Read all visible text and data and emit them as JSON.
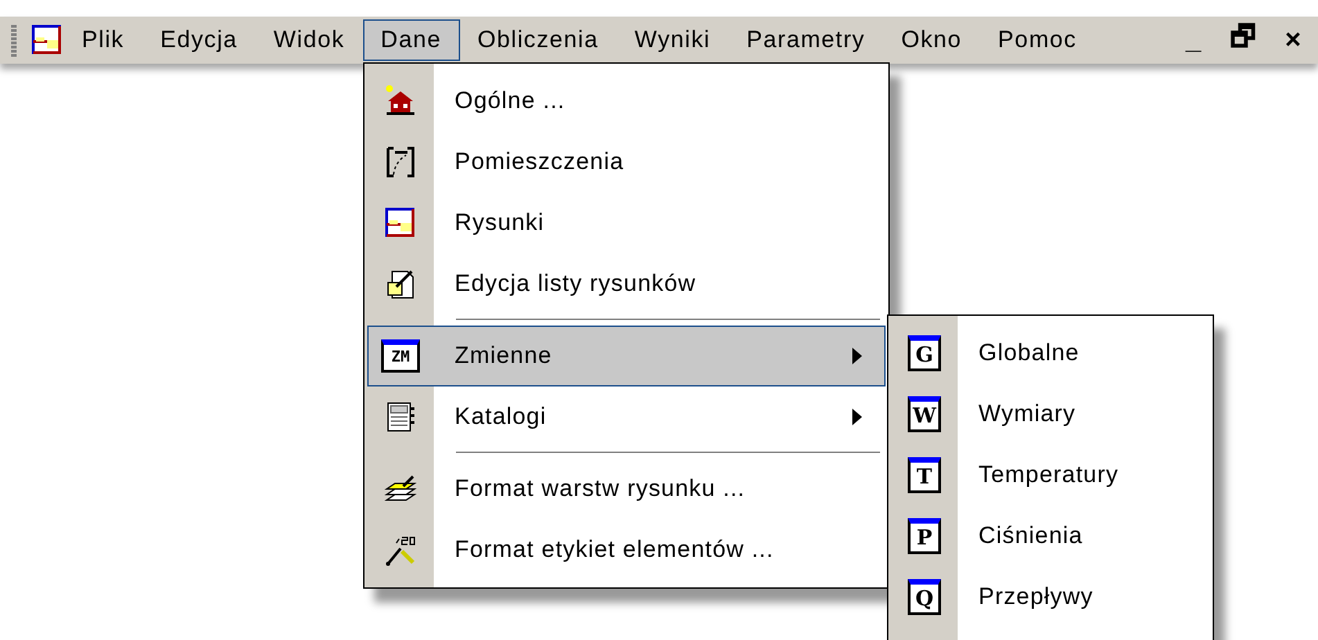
{
  "menubar": {
    "items": [
      {
        "label": "Plik",
        "selected": false
      },
      {
        "label": "Edycja",
        "selected": false
      },
      {
        "label": "Widok",
        "selected": false
      },
      {
        "label": "Dane",
        "selected": true
      },
      {
        "label": "Obliczenia",
        "selected": false
      },
      {
        "label": "Wyniki",
        "selected": false
      },
      {
        "label": "Parametry",
        "selected": false
      },
      {
        "label": "Okno",
        "selected": false
      },
      {
        "label": "Pomoc",
        "selected": false
      }
    ],
    "window_controls": [
      "_",
      "🗗",
      "×"
    ]
  },
  "menu": {
    "items": [
      {
        "kind": "item",
        "label": "Ogólne ...",
        "selected": false,
        "submenu": false
      },
      {
        "kind": "item",
        "label": "Pomieszczenia",
        "selected": false,
        "submenu": false
      },
      {
        "kind": "item",
        "label": "Rysunki",
        "selected": false,
        "submenu": false
      },
      {
        "kind": "item",
        "label": "Edycja listy rysunków",
        "selected": false,
        "submenu": false
      },
      {
        "kind": "separator"
      },
      {
        "kind": "item",
        "icon_text": "ZM",
        "label": "Zmienne",
        "selected": true,
        "submenu": true
      },
      {
        "kind": "item",
        "label": "Katalogi",
        "selected": false,
        "submenu": true
      },
      {
        "kind": "separator"
      },
      {
        "kind": "item",
        "label": "Format warstw rysunku ...",
        "selected": false,
        "submenu": false
      },
      {
        "kind": "item",
        "label": "Format etykiet elementów ...",
        "selected": false,
        "submenu": false
      }
    ]
  },
  "submenu": {
    "items": [
      {
        "icon_text": "G",
        "label": "Globalne"
      },
      {
        "icon_text": "W",
        "label": "Wymiary"
      },
      {
        "icon_text": "T",
        "label": "Temperatury"
      },
      {
        "icon_text": "P",
        "label": "Ciśnienia"
      },
      {
        "icon_text": "Q",
        "label": "Przepływy"
      }
    ]
  }
}
